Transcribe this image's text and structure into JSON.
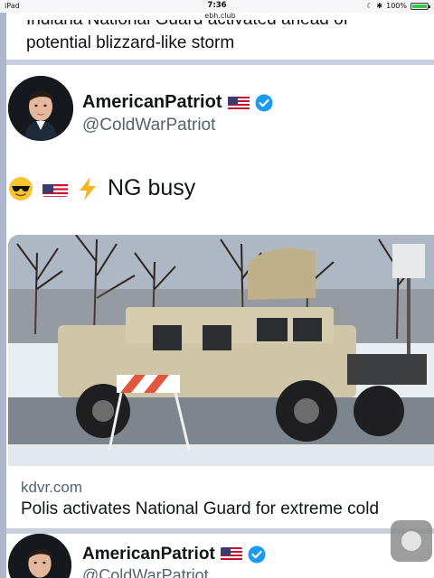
{
  "status_bar": {
    "device": "iPad",
    "time": "7:36",
    "url": "ebh.club",
    "battery": "100%"
  },
  "previous_post": {
    "headline_line1": "Indiana National Guard activated ahead of",
    "headline_line2": "potential blizzard-like storm"
  },
  "tweet": {
    "display_name": "AmericanPatriot",
    "handle": "@ColdWarPatriot",
    "text": "NG busy",
    "emojis": [
      "sunglasses-face-icon",
      "us-flag-icon",
      "lightning-icon"
    ],
    "link_card": {
      "domain": "kdvr.com",
      "title": "Polis activates National Guard for extreme cold"
    }
  },
  "next_tweet": {
    "display_name": "AmericanPatriot",
    "handle": "@ColdWarPatriot"
  },
  "colors": {
    "verified": "#1d9bf0",
    "handle": "#536471",
    "frame": "#c9cfde"
  }
}
